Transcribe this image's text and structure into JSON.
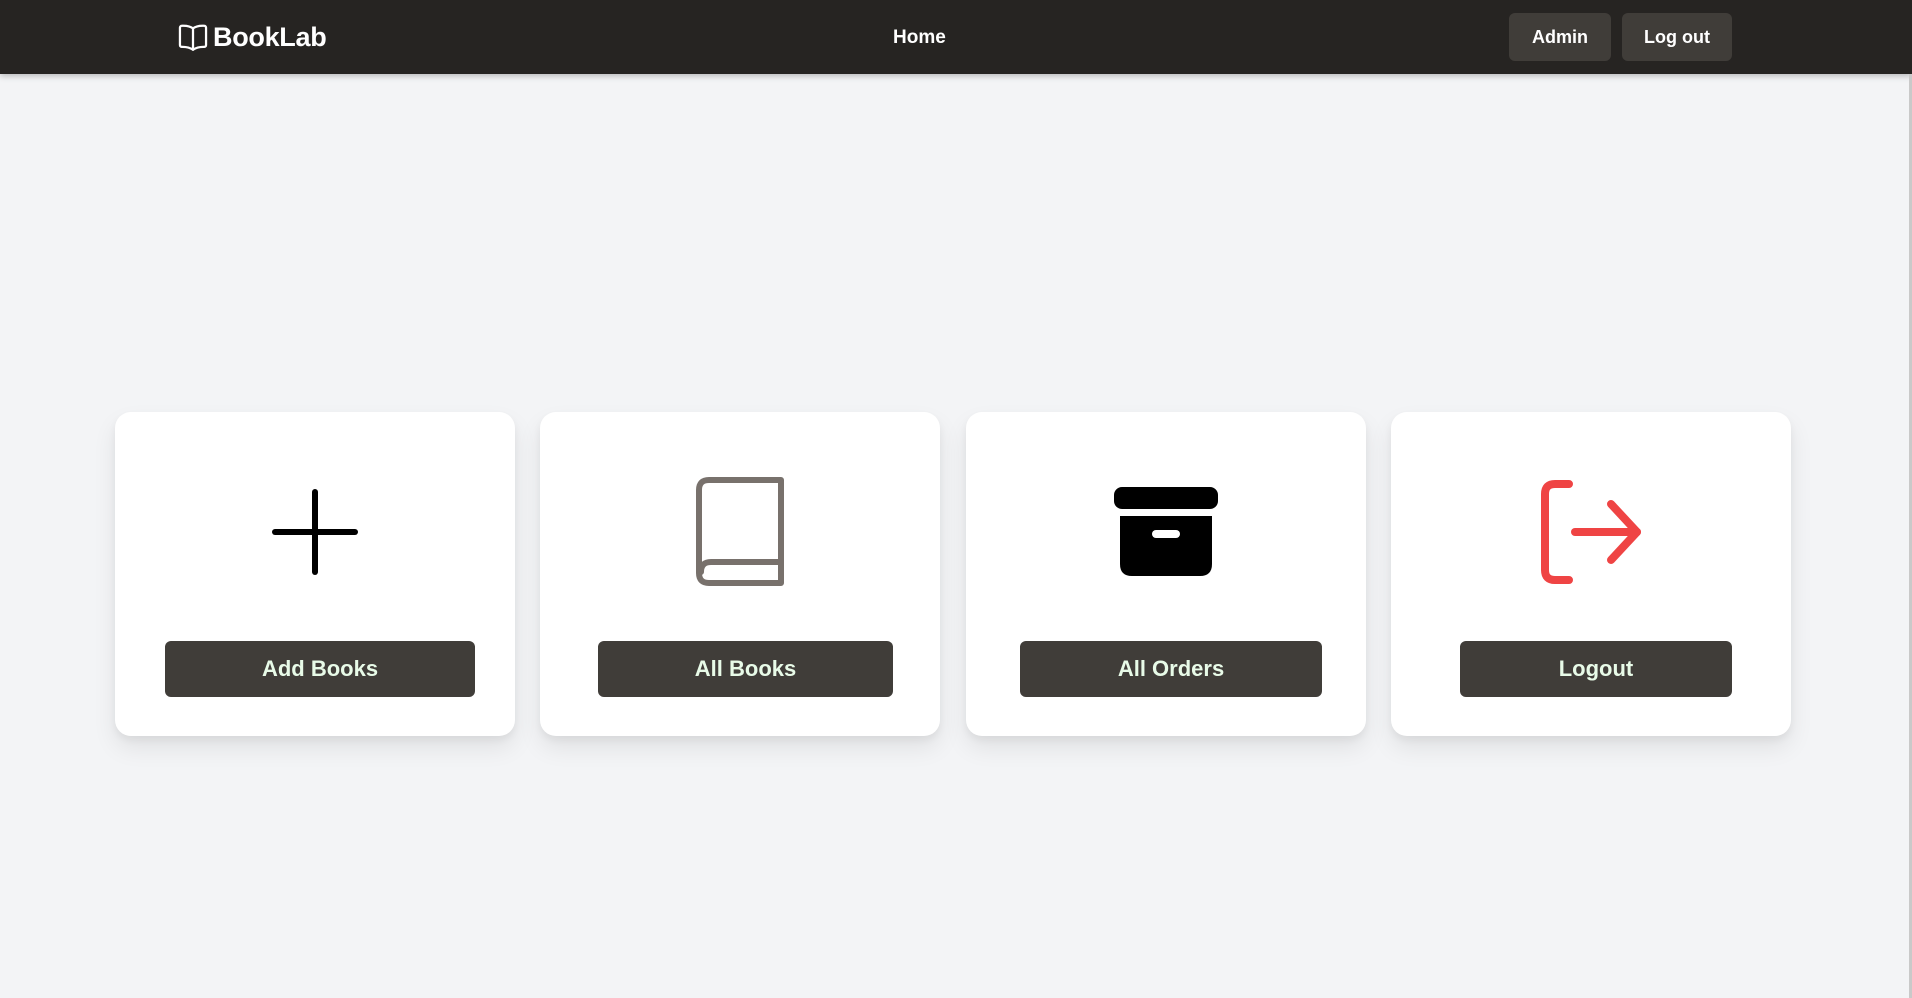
{
  "header": {
    "brand": "BookLab",
    "nav_home": "Home",
    "admin_label": "Admin",
    "logout_label": "Log out"
  },
  "cards": [
    {
      "icon": "plus-icon",
      "label": "Add Books"
    },
    {
      "icon": "book-icon",
      "label": "All Books"
    },
    {
      "icon": "archive-box-icon",
      "label": "All Orders"
    },
    {
      "icon": "logout-arrow-icon",
      "label": "Logout"
    }
  ],
  "colors": {
    "header_bg": "#262422",
    "button_bg": "#403d39",
    "page_bg": "#f3f4f6",
    "card_bg": "#ffffff",
    "book_icon": "#78716c",
    "logout_icon": "#ef4444"
  }
}
